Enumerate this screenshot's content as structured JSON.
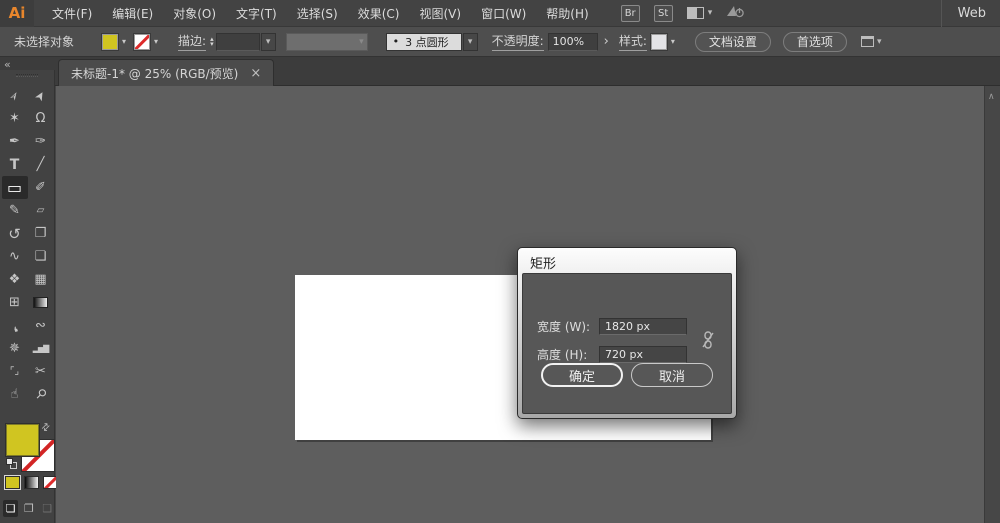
{
  "menu_bar": {
    "logo": "Ai",
    "items": [
      "文件(F)",
      "编辑(E)",
      "对象(O)",
      "文字(T)",
      "选择(S)",
      "效果(C)",
      "视图(V)",
      "窗口(W)",
      "帮助(H)"
    ],
    "bridge_label": "Br",
    "stock_label": "St",
    "workspace": "Web"
  },
  "options_bar": {
    "status": "未选择对象",
    "stroke_label": "描边:",
    "brush_bullet": "•",
    "brush_name": "3 点圆形",
    "opacity_label": "不透明度:",
    "opacity_value": "100%",
    "more_arrow": "›",
    "style_label": "样式:",
    "doc_setup_label": "文档设置",
    "preferences_label": "首选项"
  },
  "document_tab": {
    "title": "未标题-1* @ 25% (RGB/预览)",
    "close_glyph": "×"
  },
  "toolbar": {
    "collapse_glyph": "«",
    "tools": [
      {
        "name": "selection-tool",
        "glyph": "➢"
      },
      {
        "name": "direct-selection-tool",
        "glyph": "➤"
      },
      {
        "name": "magic-wand-tool",
        "glyph": "✶"
      },
      {
        "name": "lasso-tool",
        "glyph": "Ω"
      },
      {
        "name": "pen-tool",
        "glyph": "✒"
      },
      {
        "name": "calligraphy-pen-tool",
        "glyph": "✑"
      },
      {
        "name": "type-tool",
        "glyph": "T"
      },
      {
        "name": "line-tool",
        "glyph": "╱"
      },
      {
        "name": "rectangle-tool",
        "glyph": "▭"
      },
      {
        "name": "paintbrush-tool",
        "glyph": "✐"
      },
      {
        "name": "pencil-tool",
        "glyph": "✎"
      },
      {
        "name": "eraser-tool",
        "glyph": "▱"
      },
      {
        "name": "rotate-tool",
        "glyph": "↺"
      },
      {
        "name": "scale-tool",
        "glyph": "❐"
      },
      {
        "name": "width-tool",
        "glyph": "∿"
      },
      {
        "name": "free-transform-tool",
        "glyph": "❏"
      },
      {
        "name": "shape-builder-tool",
        "glyph": "❖"
      },
      {
        "name": "perspective-grid-tool",
        "glyph": "▦"
      },
      {
        "name": "mesh-tool",
        "glyph": "⊞"
      },
      {
        "name": "gradient-tool",
        "glyph": ""
      },
      {
        "name": "eyedropper-tool",
        "glyph": "❜"
      },
      {
        "name": "blend-tool",
        "glyph": "∾"
      },
      {
        "name": "symbol-sprayer-tool",
        "glyph": "✵"
      },
      {
        "name": "column-graph-tool",
        "glyph": "▂▅▇"
      },
      {
        "name": "artboard-tool",
        "glyph": "⌜⌟"
      },
      {
        "name": "slice-tool",
        "glyph": "✂"
      },
      {
        "name": "hand-tool",
        "glyph": "☝"
      },
      {
        "name": "zoom-tool",
        "glyph": "⚲"
      }
    ],
    "swap_glyph": "⇄"
  },
  "dialog": {
    "title": "矩形",
    "width_label": "宽度 (W):",
    "width_value": "1820 px",
    "height_label": "高度 (H):",
    "height_value": "720 px",
    "ok_label": "确定",
    "cancel_label": "取消"
  },
  "scrollbar": {
    "up_glyph": "∧"
  },
  "colors": {
    "fill_yellow": "#d0c521",
    "none_slash_red": "#dd2b2b",
    "canvas_gray": "#5e5e5e",
    "chrome_gray": "#454545",
    "artboard_white": "#ffffff"
  }
}
